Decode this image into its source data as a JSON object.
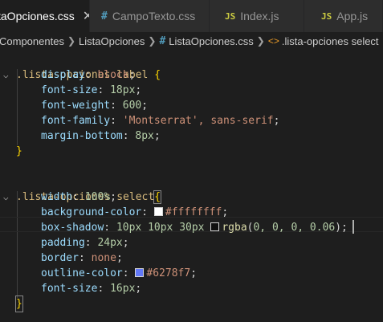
{
  "tabs": [
    {
      "icon": "",
      "label": "taOpciones.css",
      "close": "✕"
    },
    {
      "icon": "#",
      "label": "CampoTexto.css"
    },
    {
      "icon": "JS",
      "label": "Index.js"
    },
    {
      "icon": "JS",
      "label": "App.js"
    }
  ],
  "breadcrumb": {
    "folder1": "Componentes",
    "folder2": "ListaOpciones",
    "file_icon": "#",
    "file": "ListaOpciones.css",
    "symbol": ".lista-opciones select"
  },
  "code": {
    "rule1_selector": ".lista-opciones label",
    "rule1": [
      {
        "prop": "display",
        "val": "block",
        "type": "val"
      },
      {
        "prop": "font-size",
        "val": "18px",
        "type": "num"
      },
      {
        "prop": "font-weight",
        "val": "600",
        "type": "num"
      },
      {
        "prop": "font-family",
        "val": "'Montserrat'",
        "type": "val",
        "rest": ", sans-serif"
      },
      {
        "prop": "margin-bottom",
        "val": "8px",
        "type": "num"
      }
    ],
    "rule2_selector": ".lista-opciones select",
    "width": {
      "prop": "width",
      "val": "100%"
    },
    "bg": {
      "prop": "background-color",
      "val": "#ffffffff",
      "swatch": "#ffffff"
    },
    "shadow": {
      "prop": "box-shadow",
      "val1": "10px 10px 30px",
      "func": "rgba",
      "args": "0, 0, 0, 0.06",
      "swatch": "#0f0f0f"
    },
    "padding": {
      "prop": "padding",
      "val": "24px"
    },
    "border": {
      "prop": "border",
      "val": "none"
    },
    "outline": {
      "prop": "outline-color",
      "val": "#6278f7",
      "swatch": "#6278f7"
    },
    "fontsize": {
      "prop": "font-size",
      "val": "16px"
    }
  }
}
